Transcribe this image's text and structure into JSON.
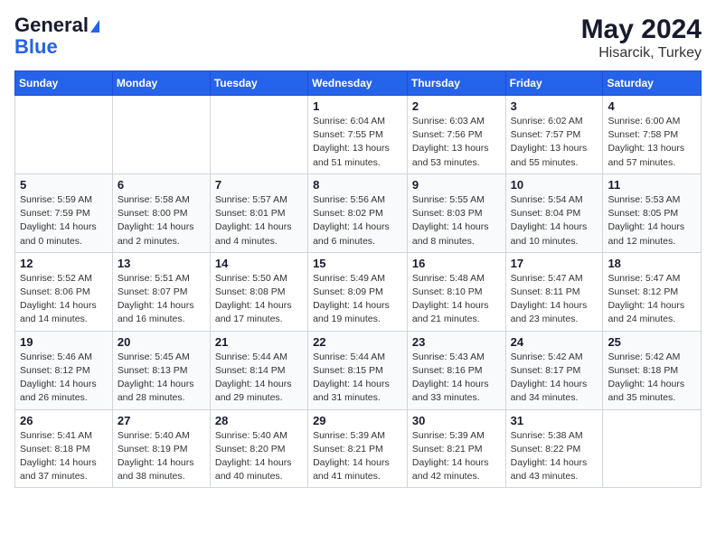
{
  "header": {
    "logo_line1": "General",
    "logo_line2": "Blue",
    "month_year": "May 2024",
    "location": "Hisarcik, Turkey"
  },
  "days_of_week": [
    "Sunday",
    "Monday",
    "Tuesday",
    "Wednesday",
    "Thursday",
    "Friday",
    "Saturday"
  ],
  "weeks": [
    [
      {
        "day": "",
        "sunrise": "",
        "sunset": "",
        "daylight": ""
      },
      {
        "day": "",
        "sunrise": "",
        "sunset": "",
        "daylight": ""
      },
      {
        "day": "",
        "sunrise": "",
        "sunset": "",
        "daylight": ""
      },
      {
        "day": "1",
        "sunrise": "Sunrise: 6:04 AM",
        "sunset": "Sunset: 7:55 PM",
        "daylight": "Daylight: 13 hours and 51 minutes."
      },
      {
        "day": "2",
        "sunrise": "Sunrise: 6:03 AM",
        "sunset": "Sunset: 7:56 PM",
        "daylight": "Daylight: 13 hours and 53 minutes."
      },
      {
        "day": "3",
        "sunrise": "Sunrise: 6:02 AM",
        "sunset": "Sunset: 7:57 PM",
        "daylight": "Daylight: 13 hours and 55 minutes."
      },
      {
        "day": "4",
        "sunrise": "Sunrise: 6:00 AM",
        "sunset": "Sunset: 7:58 PM",
        "daylight": "Daylight: 13 hours and 57 minutes."
      }
    ],
    [
      {
        "day": "5",
        "sunrise": "Sunrise: 5:59 AM",
        "sunset": "Sunset: 7:59 PM",
        "daylight": "Daylight: 14 hours and 0 minutes."
      },
      {
        "day": "6",
        "sunrise": "Sunrise: 5:58 AM",
        "sunset": "Sunset: 8:00 PM",
        "daylight": "Daylight: 14 hours and 2 minutes."
      },
      {
        "day": "7",
        "sunrise": "Sunrise: 5:57 AM",
        "sunset": "Sunset: 8:01 PM",
        "daylight": "Daylight: 14 hours and 4 minutes."
      },
      {
        "day": "8",
        "sunrise": "Sunrise: 5:56 AM",
        "sunset": "Sunset: 8:02 PM",
        "daylight": "Daylight: 14 hours and 6 minutes."
      },
      {
        "day": "9",
        "sunrise": "Sunrise: 5:55 AM",
        "sunset": "Sunset: 8:03 PM",
        "daylight": "Daylight: 14 hours and 8 minutes."
      },
      {
        "day": "10",
        "sunrise": "Sunrise: 5:54 AM",
        "sunset": "Sunset: 8:04 PM",
        "daylight": "Daylight: 14 hours and 10 minutes."
      },
      {
        "day": "11",
        "sunrise": "Sunrise: 5:53 AM",
        "sunset": "Sunset: 8:05 PM",
        "daylight": "Daylight: 14 hours and 12 minutes."
      }
    ],
    [
      {
        "day": "12",
        "sunrise": "Sunrise: 5:52 AM",
        "sunset": "Sunset: 8:06 PM",
        "daylight": "Daylight: 14 hours and 14 minutes."
      },
      {
        "day": "13",
        "sunrise": "Sunrise: 5:51 AM",
        "sunset": "Sunset: 8:07 PM",
        "daylight": "Daylight: 14 hours and 16 minutes."
      },
      {
        "day": "14",
        "sunrise": "Sunrise: 5:50 AM",
        "sunset": "Sunset: 8:08 PM",
        "daylight": "Daylight: 14 hours and 17 minutes."
      },
      {
        "day": "15",
        "sunrise": "Sunrise: 5:49 AM",
        "sunset": "Sunset: 8:09 PM",
        "daylight": "Daylight: 14 hours and 19 minutes."
      },
      {
        "day": "16",
        "sunrise": "Sunrise: 5:48 AM",
        "sunset": "Sunset: 8:10 PM",
        "daylight": "Daylight: 14 hours and 21 minutes."
      },
      {
        "day": "17",
        "sunrise": "Sunrise: 5:47 AM",
        "sunset": "Sunset: 8:11 PM",
        "daylight": "Daylight: 14 hours and 23 minutes."
      },
      {
        "day": "18",
        "sunrise": "Sunrise: 5:47 AM",
        "sunset": "Sunset: 8:12 PM",
        "daylight": "Daylight: 14 hours and 24 minutes."
      }
    ],
    [
      {
        "day": "19",
        "sunrise": "Sunrise: 5:46 AM",
        "sunset": "Sunset: 8:12 PM",
        "daylight": "Daylight: 14 hours and 26 minutes."
      },
      {
        "day": "20",
        "sunrise": "Sunrise: 5:45 AM",
        "sunset": "Sunset: 8:13 PM",
        "daylight": "Daylight: 14 hours and 28 minutes."
      },
      {
        "day": "21",
        "sunrise": "Sunrise: 5:44 AM",
        "sunset": "Sunset: 8:14 PM",
        "daylight": "Daylight: 14 hours and 29 minutes."
      },
      {
        "day": "22",
        "sunrise": "Sunrise: 5:44 AM",
        "sunset": "Sunset: 8:15 PM",
        "daylight": "Daylight: 14 hours and 31 minutes."
      },
      {
        "day": "23",
        "sunrise": "Sunrise: 5:43 AM",
        "sunset": "Sunset: 8:16 PM",
        "daylight": "Daylight: 14 hours and 33 minutes."
      },
      {
        "day": "24",
        "sunrise": "Sunrise: 5:42 AM",
        "sunset": "Sunset: 8:17 PM",
        "daylight": "Daylight: 14 hours and 34 minutes."
      },
      {
        "day": "25",
        "sunrise": "Sunrise: 5:42 AM",
        "sunset": "Sunset: 8:18 PM",
        "daylight": "Daylight: 14 hours and 35 minutes."
      }
    ],
    [
      {
        "day": "26",
        "sunrise": "Sunrise: 5:41 AM",
        "sunset": "Sunset: 8:18 PM",
        "daylight": "Daylight: 14 hours and 37 minutes."
      },
      {
        "day": "27",
        "sunrise": "Sunrise: 5:40 AM",
        "sunset": "Sunset: 8:19 PM",
        "daylight": "Daylight: 14 hours and 38 minutes."
      },
      {
        "day": "28",
        "sunrise": "Sunrise: 5:40 AM",
        "sunset": "Sunset: 8:20 PM",
        "daylight": "Daylight: 14 hours and 40 minutes."
      },
      {
        "day": "29",
        "sunrise": "Sunrise: 5:39 AM",
        "sunset": "Sunset: 8:21 PM",
        "daylight": "Daylight: 14 hours and 41 minutes."
      },
      {
        "day": "30",
        "sunrise": "Sunrise: 5:39 AM",
        "sunset": "Sunset: 8:21 PM",
        "daylight": "Daylight: 14 hours and 42 minutes."
      },
      {
        "day": "31",
        "sunrise": "Sunrise: 5:38 AM",
        "sunset": "Sunset: 8:22 PM",
        "daylight": "Daylight: 14 hours and 43 minutes."
      },
      {
        "day": "",
        "sunrise": "",
        "sunset": "",
        "daylight": ""
      }
    ]
  ]
}
